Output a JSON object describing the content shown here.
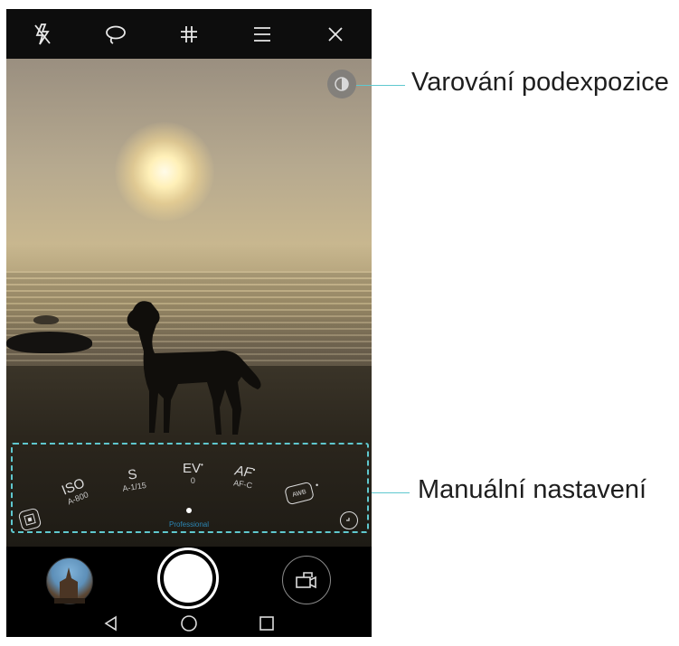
{
  "topbar": {
    "icons": [
      "flash-off-icon",
      "lasso-icon",
      "grid-icon",
      "menu-icon",
      "close-icon"
    ]
  },
  "manual_settings": {
    "iso": {
      "label": "ISO",
      "value": "A-800"
    },
    "shutter": {
      "label": "S",
      "value": "A-1/15"
    },
    "ev": {
      "label": "EV",
      "value": "0"
    },
    "af": {
      "label": "AF",
      "value": "AF-C"
    },
    "awb_label": "AWB",
    "mode_label": "Professional"
  },
  "callouts": {
    "underexposure_warning": "Varování podexpozice",
    "manual_settings": "Manuální nastavení"
  },
  "colors": {
    "callout_accent": "#5fc8cf",
    "mode_label": "#2b86b4"
  }
}
